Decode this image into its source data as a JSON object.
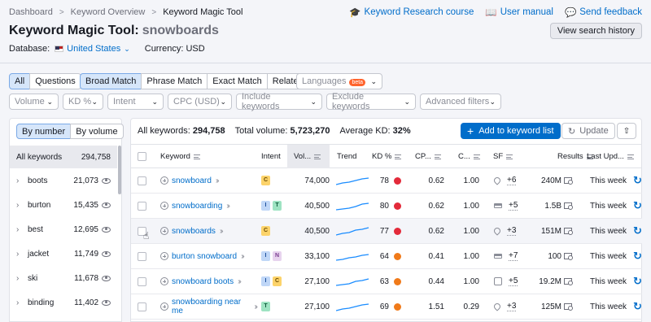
{
  "breadcrumb": [
    "Dashboard",
    "Keyword Overview",
    "Keyword Magic Tool"
  ],
  "links": {
    "course": "Keyword Research course",
    "manual": "User manual",
    "feedback": "Send feedback"
  },
  "title": {
    "tool": "Keyword Magic Tool:",
    "keyword": "snowboards"
  },
  "view_history": "View search history",
  "database": {
    "label": "Database:",
    "value": "United States",
    "currency": "Currency: USD"
  },
  "match_tabs": [
    "All",
    "Questions",
    "Broad Match",
    "Phrase Match",
    "Exact Match",
    "Related"
  ],
  "languages": {
    "label": "Languages",
    "badge": "beta"
  },
  "filters": [
    "Volume",
    "KD %",
    "Intent",
    "CPC (USD)",
    "Include keywords",
    "Exclude keywords",
    "Advanced filters"
  ],
  "sidebar": {
    "sort_by_number": "By number",
    "sort_by_volume": "By volume",
    "all_label": "All keywords",
    "all_count": "294,758",
    "groups": [
      {
        "name": "boots",
        "count": "21,073"
      },
      {
        "name": "burton",
        "count": "15,435"
      },
      {
        "name": "best",
        "count": "12,695"
      },
      {
        "name": "jacket",
        "count": "11,749"
      },
      {
        "name": "ski",
        "count": "11,678"
      },
      {
        "name": "binding",
        "count": "11,402"
      }
    ]
  },
  "summary": {
    "all_label": "All keywords:",
    "all_value": "294,758",
    "volume_label": "Total volume:",
    "volume_value": "5,723,270",
    "kd_label": "Average KD:",
    "kd_value": "32%"
  },
  "actions": {
    "add": "Add to keyword list",
    "update": "Update"
  },
  "columns": [
    "Keyword",
    "Intent",
    "Vol...",
    "Trend",
    "KD %",
    "CP...",
    "C...",
    "SF",
    "Results",
    "Last Upd..."
  ],
  "rows": [
    {
      "keyword": "snowboard",
      "intent": [
        "C"
      ],
      "volume": "74,000",
      "kd": "78",
      "kd_color": "#e32a3a",
      "cpc": "0.62",
      "com": "1.00",
      "sf_icon": "pin",
      "sf": "+6",
      "results": "240M",
      "updated": "This week"
    },
    {
      "keyword": "snowboarding",
      "intent": [
        "I",
        "T"
      ],
      "volume": "40,500",
      "kd": "80",
      "kd_color": "#e32a3a",
      "cpc": "0.62",
      "com": "1.00",
      "sf_icon": "cap",
      "sf": "+5",
      "results": "1.5B",
      "updated": "This week"
    },
    {
      "keyword": "snowboards",
      "intent": [
        "C"
      ],
      "volume": "40,500",
      "kd": "77",
      "kd_color": "#e32a3a",
      "cpc": "0.62",
      "com": "1.00",
      "sf_icon": "pin",
      "sf": "+3",
      "results": "151M",
      "updated": "This week"
    },
    {
      "keyword": "burton snowboard",
      "intent": [
        "I",
        "N"
      ],
      "volume": "33,100",
      "kd": "64",
      "kd_color": "#f07a1a",
      "cpc": "0.41",
      "com": "1.00",
      "sf_icon": "cap",
      "sf": "+7",
      "results": "100",
      "updated": "This week"
    },
    {
      "keyword": "snowboard boots",
      "intent": [
        "I",
        "C"
      ],
      "volume": "27,100",
      "kd": "63",
      "kd_color": "#f07a1a",
      "cpc": "0.44",
      "com": "1.00",
      "sf_icon": "img",
      "sf": "+5",
      "results": "19.2M",
      "updated": "This week"
    },
    {
      "keyword": "snowboarding near me",
      "intent": [
        "T"
      ],
      "volume": "27,100",
      "kd": "69",
      "kd_color": "#f07a1a",
      "cpc": "1.51",
      "com": "0.29",
      "sf_icon": "pin",
      "sf": "+3",
      "results": "125M",
      "updated": "This week"
    }
  ]
}
